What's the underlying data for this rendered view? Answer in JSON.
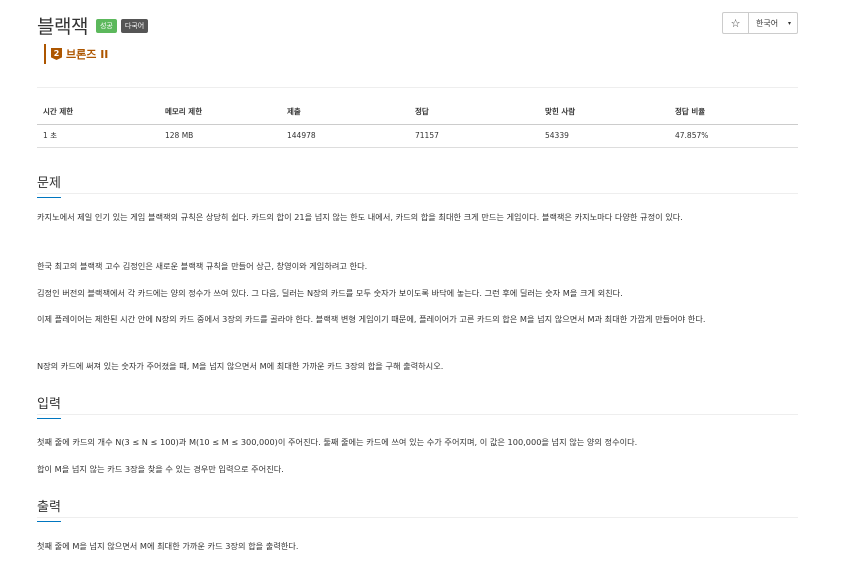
{
  "problem": {
    "title": "블랙잭",
    "badges": {
      "status": "성공",
      "multi_lang": "다국어"
    },
    "tier": {
      "number": "2",
      "label": "브론즈 II"
    }
  },
  "controls": {
    "star_icon": "☆",
    "language": "한국어",
    "caret": "▾"
  },
  "info_table": {
    "headers": [
      "시간 제한",
      "메모리 제한",
      "제출",
      "정답",
      "맞힌 사람",
      "정답 비율"
    ],
    "values": [
      "1 초",
      "128 MB",
      "144978",
      "71157",
      "54339",
      "47.857%"
    ]
  },
  "sections": {
    "description": {
      "title": "문제",
      "paragraphs": [
        "카지노에서 제일 인기 있는 게임 블랙잭의 규칙은 상당히 쉽다. 카드의 합이 21을 넘지 않는 한도 내에서, 카드의 합을 최대한 크게 만드는 게임이다. 블랙잭은 카지노마다 다양한 규정이 있다.",
        "한국 최고의 블랙잭 고수 김정인은 새로운 블랙잭 규칙을 만들어 상근, 창영이와 게임하려고 한다.",
        "김정인 버전의 블랙잭에서 각 카드에는 양의 정수가 쓰여 있다. 그 다음, 딜러는 N장의 카드를 모두 숫자가 보이도록 바닥에 놓는다. 그런 후에 딜러는 숫자 M을 크게 외친다.",
        "이제 플레이어는 제한된 시간 안에 N장의 카드 중에서 3장의 카드를 골라야 한다. 블랙잭 변형 게임이기 때문에, 플레이어가 고른 카드의 합은 M을 넘지 않으면서 M과 최대한 가깝게 만들어야 한다.",
        "N장의 카드에 써져 있는 숫자가 주어졌을 때, M을 넘지 않으면서 M에 최대한 가까운 카드 3장의 합을 구해 출력하시오."
      ]
    },
    "input": {
      "title": "입력",
      "paragraphs": [
        "첫째 줄에 카드의 개수 N(3 ≤ N ≤ 100)과 M(10 ≤ M ≤ 300,000)이 주어진다. 둘째 줄에는 카드에 쓰여 있는 수가 주어지며, 이 값은 100,000을 넘지 않는 양의 정수이다.",
        "합이 M을 넘지 않는 카드 3장을 찾을 수 있는 경우만 입력으로 주어진다."
      ]
    },
    "output": {
      "title": "출력",
      "paragraphs": [
        "첫째 줄에 M을 넘지 않으면서 M에 최대한 가까운 카드 3장의 합을 출력한다."
      ]
    }
  }
}
